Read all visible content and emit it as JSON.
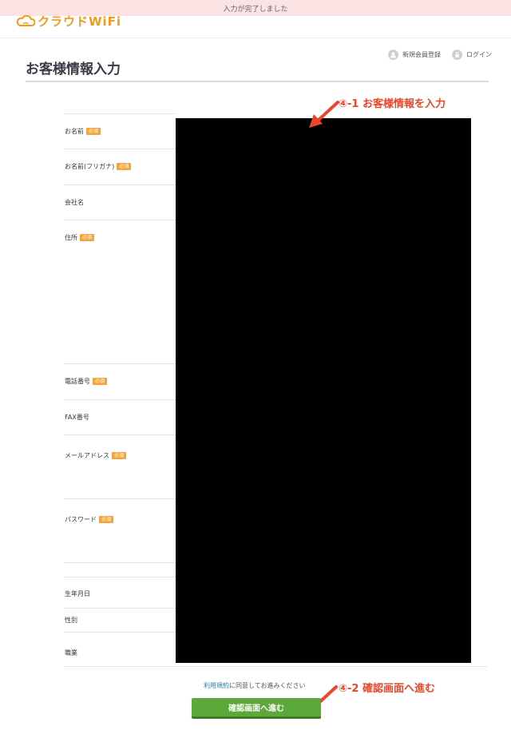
{
  "toast": {
    "message": "入力が完了しました"
  },
  "header": {
    "logo_text": "クラウドWiFi"
  },
  "usernav": {
    "register_label": "新規会員登録",
    "login_label": "ログイン"
  },
  "page": {
    "title": "お客様情報入力"
  },
  "form": {
    "required_badge": "必須",
    "fields": [
      {
        "label": "お名前",
        "required": true
      },
      {
        "label": "お名前(フリガナ)",
        "required": true
      },
      {
        "label": "会社名",
        "required": false
      },
      {
        "label": "住所",
        "required": true
      },
      {
        "label": "電話番号",
        "required": true
      },
      {
        "label": "FAX番号",
        "required": false
      },
      {
        "label": "メールアドレス",
        "required": true
      },
      {
        "label": "パスワード",
        "required": true
      },
      {
        "label": "",
        "required": false
      },
      {
        "label": "生年月日",
        "required": false
      },
      {
        "label": "性別",
        "required": false
      },
      {
        "label": "職業",
        "required": false
      }
    ]
  },
  "annotations": {
    "step1": "④-1 お客様情報を入力",
    "step2": "④-2 確認画面へ進む"
  },
  "terms": {
    "link_text": "利用規約",
    "suffix_text": "に同意してお進みください"
  },
  "submit": {
    "label": "確認画面へ進む"
  },
  "colors": {
    "accent": "#e9462a",
    "primary_button": "#5da83a",
    "logo": "#f39a1e",
    "required": "#f3a53a"
  }
}
